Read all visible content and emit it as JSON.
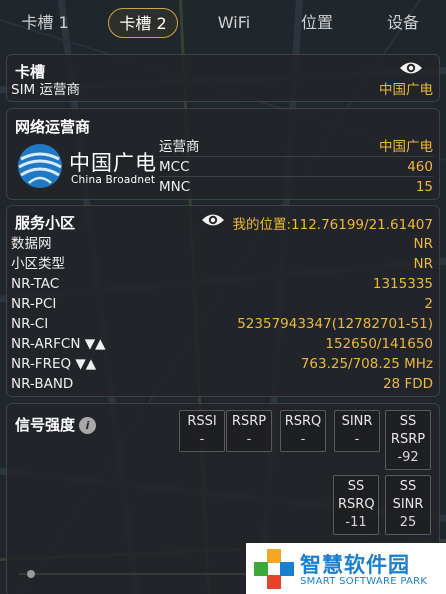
{
  "colors": {
    "accent": "#f0b838",
    "tab_border": "#c9a44a",
    "panel_bg": "#222428"
  },
  "tabs": [
    "卡槽 1",
    "卡槽 2",
    "WiFi",
    "位置",
    "设备"
  ],
  "active_tab": "卡槽 2",
  "sim_panel": {
    "title": "卡槽",
    "eye_icon": "eye-icon",
    "rows": [
      {
        "key": "SIM 运营商",
        "value": "中国广电"
      }
    ]
  },
  "operator_panel": {
    "title": "网络运营商",
    "logo_text": "中国广电",
    "logo_subtext": "China Broadnet",
    "rows": [
      {
        "key": "运营商",
        "value": "中国广电"
      },
      {
        "key": "MCC",
        "value": "460"
      },
      {
        "key": "MNC",
        "value": "15"
      }
    ]
  },
  "cell_panel": {
    "title": "服务小区",
    "eye_icon": "eye-icon",
    "location": "我的位置:112.76199/21.61407",
    "rows": [
      {
        "key": "数据网",
        "value": "NR"
      },
      {
        "key": "小区类型",
        "value": "NR"
      },
      {
        "key": "NR-TAC",
        "value": "1315335"
      },
      {
        "key": "NR-PCI",
        "value": "2"
      },
      {
        "key": "NR-CI",
        "value": "52357943347(12782701-51)"
      },
      {
        "key": "NR-ARFCN ▼▲",
        "value": "152650/141650"
      },
      {
        "key": "NR-FREQ ▼▲",
        "value": "763.25/708.25 MHz"
      },
      {
        "key": "NR-BAND",
        "value": "28 FDD"
      }
    ]
  },
  "signal_panel": {
    "title": "信号强度",
    "info_icon": "info-icon",
    "metrics": [
      {
        "label": "RSSI",
        "value": "-"
      },
      {
        "label": "RSRP",
        "value": "-"
      },
      {
        "label": "RSRQ",
        "value": "-"
      },
      {
        "label": "SINR",
        "value": "-"
      },
      {
        "label": "SS RSRP",
        "value": "-92"
      },
      {
        "label": "SS RSRQ",
        "value": "-11"
      },
      {
        "label": "SS SINR",
        "value": "25"
      }
    ]
  },
  "watermark": {
    "title": "智慧软件园",
    "subtitle": "SMART SOFTWARE PARK"
  }
}
